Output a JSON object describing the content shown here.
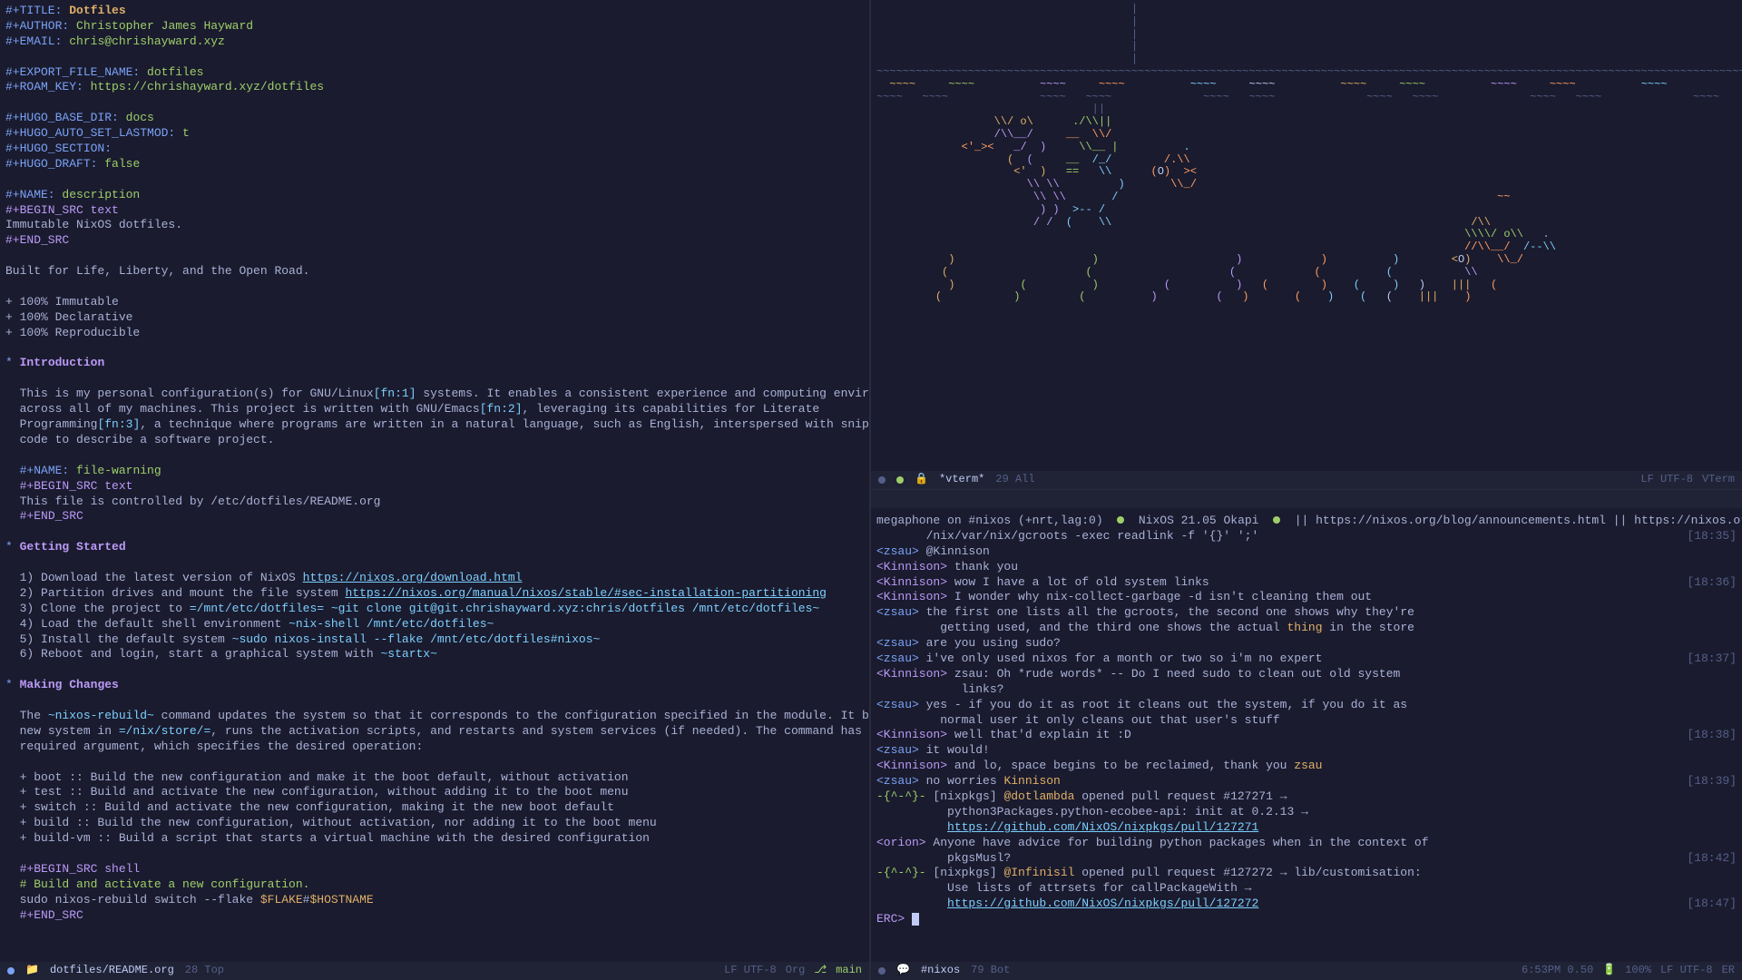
{
  "org": {
    "meta": {
      "title_key": "#+TITLE:",
      "title_val": "Dotfiles",
      "author_key": "#+AUTHOR:",
      "author_val": "Christopher James Hayward",
      "email_key": "#+EMAIL:",
      "email_val": "chris@chrishayward.xyz",
      "export_key": "#+EXPORT_FILE_NAME:",
      "export_val": "dotfiles",
      "roam_key": "#+ROAM_KEY:",
      "roam_val": "https://chrishayward.xyz/dotfiles",
      "hugo_base_key": "#+HUGO_BASE_DIR:",
      "hugo_base_val": "docs",
      "hugo_lastmod_key": "#+HUGO_AUTO_SET_LASTMOD:",
      "hugo_lastmod_val": "t",
      "hugo_section_key": "#+HUGO_SECTION:",
      "hugo_draft_key": "#+HUGO_DRAFT:",
      "hugo_draft_val": "false",
      "name_key": "#+NAME:",
      "name_val": "description",
      "begin_src": "#+BEGIN_SRC text",
      "desc_body": "Immutable NixOS dotfiles.",
      "end_src": "#+END_SRC",
      "tagline": "Built for Life, Liberty, and the Open Road.",
      "feat1": "+ 100% Immutable",
      "feat2": "+ 100% Declarative",
      "feat3": "+ 100% Reproducible"
    },
    "intro": {
      "heading": "Introduction",
      "p1a": "This is my personal configuration(s) for GNU/Linux",
      "fn1": "[fn:1]",
      "p1b": " systems. It enables a consistent experience and computing environment",
      "p2a": "across all of my machines. This project is written with GNU/Emacs",
      "fn2": "[fn:2]",
      "p2b": ", leveraging its capabilities for Literate",
      "p3a": "Programming",
      "fn3": "[fn:3]",
      "p3b": ", a technique where programs are written in a natural language, such as English, interspersed with snippets of",
      "p4": "code to describe a software project.",
      "warn_name": "file-warning",
      "warn_body": "This file is controlled by /etc/dotfiles/README.org"
    },
    "getting": {
      "heading": "Getting Started",
      "s1a": "1) Download the latest version of NixOS ",
      "s1link": "https://nixos.org/download.html",
      "s2a": "2) Partition drives and mount the file system ",
      "s2link": "https://nixos.org/manual/nixos/stable/#sec-installation-partitioning",
      "s3a": "3) Clone the project to ",
      "s3c1": "=/mnt/etc/dotfiles=",
      "s3c2": " ~git clone git@git.chrishayward.xyz:chris/dotfiles /mnt/etc/dotfiles~",
      "s4a": "4) Load the default shell environment ",
      "s4c": "~nix-shell /mnt/etc/dotfiles~",
      "s5a": "5) Install the default system ",
      "s5c": "~sudo nixos-install --flake /mnt/etc/dotfiles#nixos~",
      "s6a": "6) Reboot and login, start a graphical system with ",
      "s6c": "~startx~"
    },
    "making": {
      "heading": "Making Changes",
      "p1a": "The ",
      "p1c": "~nixos-rebuild~",
      "p1b": " command updates the system so that it corresponds to the configuration specified in the module. It builds the",
      "p2a": "new system in ",
      "p2c": "=/nix/store/=",
      "p2b": ", runs the activation scripts, and restarts and system services (if needed). The command has one",
      "p3": "required argument, which specifies the desired operation:",
      "b1": "+ boot :: Build the new configuration and make it the boot default, without activation",
      "b2": "+ test :: Build and activate the new configuration, without adding it to the boot menu",
      "b3": "+ switch :: Build and activate the new configuration, making it the new boot default",
      "b4": "+ build :: Build the new configuration, without activation, nor adding it to the boot menu",
      "b5": "+ build-vm :: Build a script that starts a virtual machine with the desired configuration",
      "src_begin": "#+BEGIN_SRC shell",
      "src_comment": "# Build and activate a new configuration.",
      "src_cmd_a": "sudo nixos-rebuild switch --flake ",
      "src_var1": "$FLAKE",
      "src_hash": "#",
      "src_var2": "$HOSTNAME",
      "src_end": "#+END_SRC"
    }
  },
  "modeline_left": {
    "buffer": "dotfiles/README.org",
    "pos": "28 Top",
    "enc": "LF UTF-8",
    "mode": "Org",
    "branch": "main"
  },
  "modeline_tr": {
    "buffer": "*vterm*",
    "pos": "29 All",
    "enc": "LF UTF-8",
    "mode": "VTerm"
  },
  "modeline_br": {
    "buffer": "#nixos",
    "pos": "79 Bot",
    "time": "6:53PM 0.50",
    "bat": "100%",
    "enc": "LF UTF-8",
    "mode": "ER"
  },
  "irc": {
    "topic_a": "megaphone on #nixos (+nrt,lag:0)",
    "topic_b": "NixOS 21.05 Okapi",
    "topic_c": "|| https://nixos.org/blog/announcements.html || https://nixos.org || Latest NixO",
    "topic_d": "/nix/var/nix/gcroots -exec readlink -f '{}' ';'",
    "t1": "[18:35]",
    "m1_n": "<zsau>",
    "m1_t": " @Kinnison",
    "m2_n": "<Kinnison>",
    "m2_t": " thank you",
    "m3_n": "<Kinnison>",
    "m3_t": " wow I have a lot of old system links",
    "t3": "[18:36]",
    "m4_n": "<Kinnison>",
    "m4_t": " I wonder why nix-collect-garbage -d isn't cleaning them out",
    "m5_n": "<zsau>",
    "m5_t": " the first one lists all the gcroots, the second one shows why they're",
    "m5b": "         getting used, and the third one shows the actual ",
    "m5c": "thing",
    "m5d": " in the store",
    "m6_n": "<zsau>",
    "m6_t": " are you using sudo?",
    "m7_n": "<zsau>",
    "m7_t": " i've only used nixos for a month or two so i'm no expert",
    "t7": "[18:37]",
    "m8_n": "<Kinnison>",
    "m8_t": " zsau: Oh *rude words* -- Do I need sudo to clean out old system",
    "m8b": "            links?",
    "m9_n": "<zsau>",
    "m9_t": " yes - if you do it as root it cleans out the system, if you do it as",
    "m9b": "         normal user it only cleans out that user's stuff",
    "m10_n": "<Kinnison>",
    "m10_t": " well that'd explain it :D",
    "t10": "[18:38]",
    "m11_n": "<zsau>",
    "m11_t": " it would!",
    "m12_n": "<Kinnison>",
    "m12_t": " and lo, space begins to be reclaimed, thank you ",
    "m12c": "zsau",
    "m13_n": "<zsau>",
    "m13_t": " no worries ",
    "m13c": "Kinnison",
    "t13": "[18:39]",
    "m14_n": "-{^-^}-",
    "m14_t": " [nixpkgs] ",
    "m14_u": "@dotlambda",
    "m14_r": " opened pull request #127271 →",
    "m14b": "          python3Packages.python-ecobee-api: init at 0.2.13 →",
    "m14l": "https://github.com/NixOS/nixpkgs/pull/127271",
    "m15_n": "<orion>",
    "m15_t": " Anyone have advice for building python packages when in the context of",
    "m15b": "          pkgsMusl?",
    "t15": "[18:42]",
    "m16_n": "-{^-^}-",
    "m16_t": " [nixpkgs] ",
    "m16_u": "@Infinisil",
    "m16_r": " opened pull request #127272 → lib/customisation:",
    "m16b": "          Use lists of attrsets for callPackageWith →",
    "m16l": "https://github.com/NixOS/nixpkgs/pull/127272",
    "t16": "[18:47]",
    "prompt": "ERC> "
  },
  "ascii": {
    "line": "~~~~~~~~~~~~~~~~~~~~~~~~~~~~~~~~~~~~~~~~~~~~~~~~~~~~~~~~~~~~~~~~~~~~~~~~~~~~~~~~~~~~~~~~~~~~~~~~~~~~~~~~~~~~~~~~~~~~~~~~~~~~~~~~~~~~~~~~~~~~~~~~~~~~~~~~"
  }
}
